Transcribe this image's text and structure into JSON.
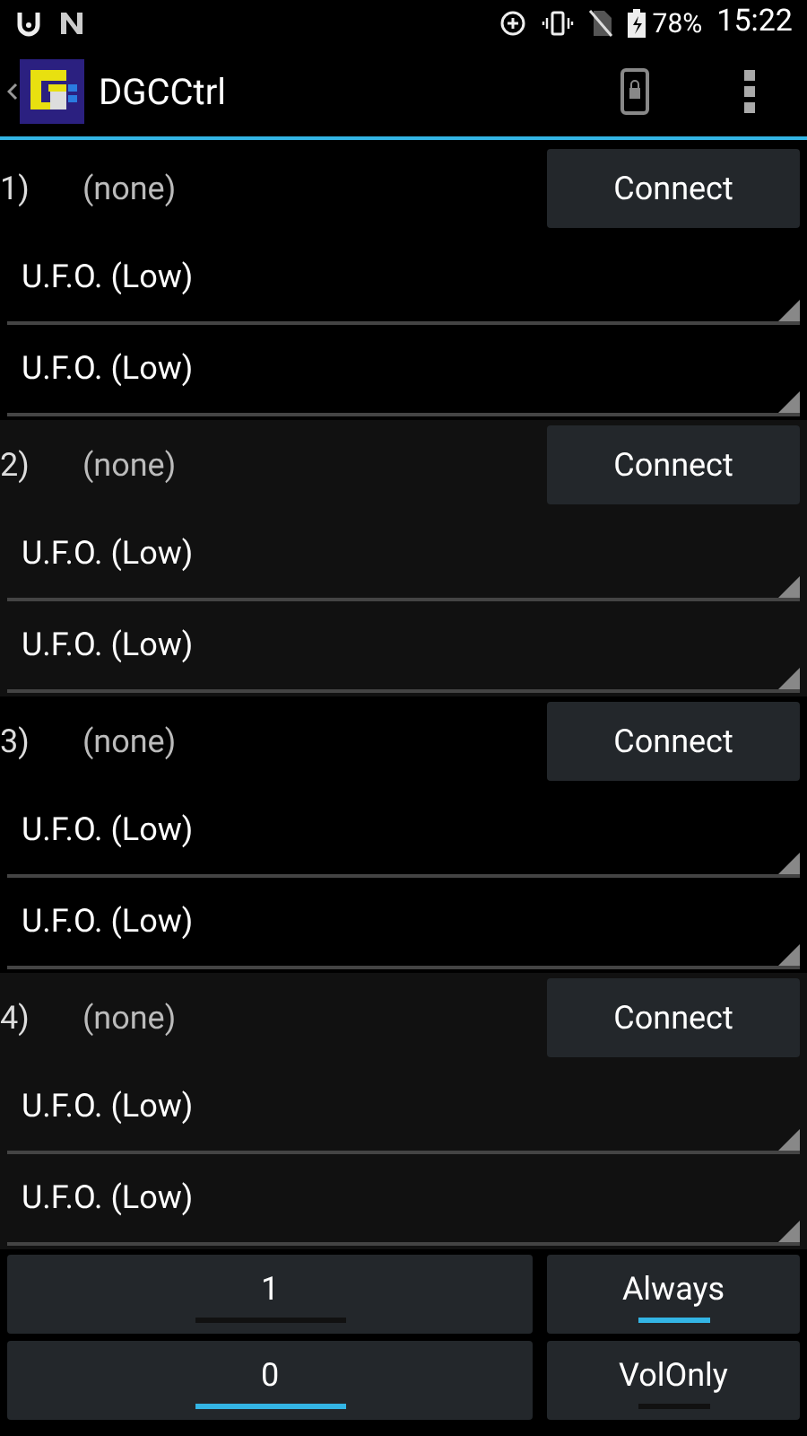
{
  "status_bar": {
    "battery": "78%",
    "time": "15:22"
  },
  "app_bar": {
    "title": "DGCCtrl"
  },
  "devices": [
    {
      "number": "1)",
      "name": "(none)",
      "connect": "Connect",
      "spinners": [
        "U.F.O. (Low)",
        "U.F.O. (Low)"
      ]
    },
    {
      "number": "2)",
      "name": "(none)",
      "connect": "Connect",
      "spinners": [
        "U.F.O. (Low)",
        "U.F.O. (Low)"
      ]
    },
    {
      "number": "3)",
      "name": "(none)",
      "connect": "Connect",
      "spinners": [
        "U.F.O. (Low)",
        "U.F.O. (Low)"
      ]
    },
    {
      "number": "4)",
      "name": "(none)",
      "connect": "Connect",
      "spinners": [
        "U.F.O. (Low)",
        "U.F.O. (Low)"
      ]
    }
  ],
  "toggles": [
    [
      {
        "label": "1",
        "selected": false
      },
      {
        "label": "Always",
        "selected": true
      }
    ],
    [
      {
        "label": "0",
        "selected": true
      },
      {
        "label": "VolOnly",
        "selected": false
      }
    ]
  ]
}
